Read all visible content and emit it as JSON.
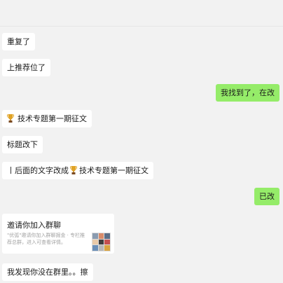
{
  "messages": {
    "m1": "重复了",
    "m2": "上推荐位了",
    "m3": "我找到了，在改",
    "m4": "技术专题第一期征文",
    "m5": "标题改下",
    "m6_before": "丨后面的文字改成",
    "m6_after": "技术专题第一期征文",
    "m7": "已改",
    "m8": "我发现你没在群里。。擦"
  },
  "invite_card": {
    "title": "邀请你加入群聊",
    "description": "\"优弧\"邀请你加入群聊掘金 · 专栏推荐总群，进入可查看详情。"
  },
  "icons": {
    "trophy": "trophy-emoji",
    "group_avatar": "group-avatar-grid"
  },
  "colors": {
    "background": "#f2f2f2",
    "incoming_bubble": "#ffffff",
    "outgoing_bubble": "#95ec69"
  }
}
